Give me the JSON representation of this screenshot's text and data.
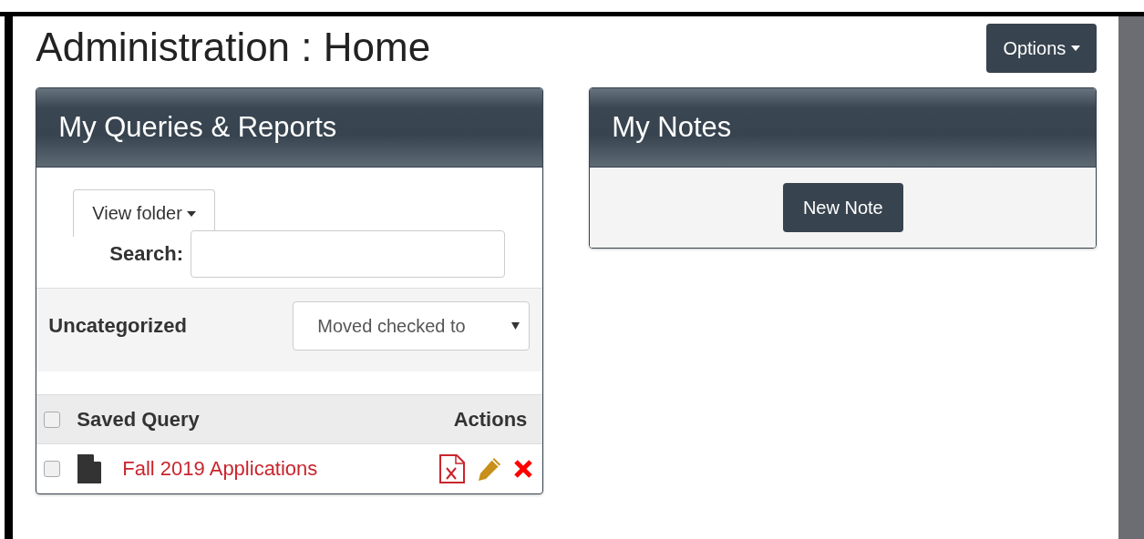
{
  "page": {
    "title": "Administration : Home",
    "options_button": "Options"
  },
  "queries_panel": {
    "title": "My Queries & Reports",
    "tab": {
      "label": "View folder",
      "selected": true
    },
    "search_label": "Search:",
    "category": "Uncategorized",
    "move_select": {
      "value": "Moved checked to"
    },
    "table": {
      "columns": [
        "Saved Query",
        "Actions"
      ],
      "header_checked": false,
      "rows": [
        {
          "name": "Fall 2019 Applications",
          "checked": false
        }
      ]
    }
  },
  "notes_panel": {
    "title": "My Notes",
    "button": "New Note"
  }
}
